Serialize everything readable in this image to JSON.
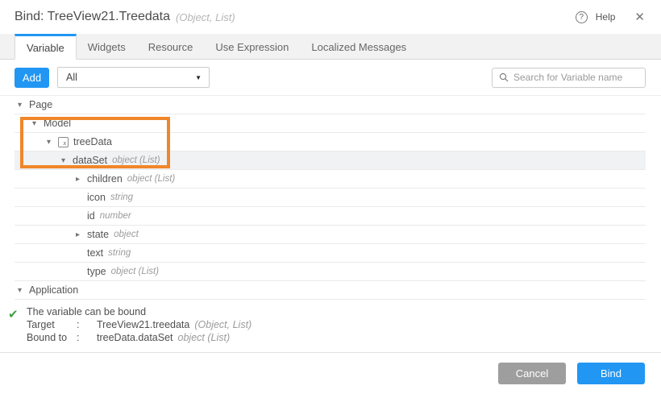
{
  "dialog": {
    "title": "Bind: TreeView21.Treedata",
    "title_type": "(Object, List)",
    "help_label": "Help",
    "help_glyph": "?",
    "close_glyph": "✕"
  },
  "tabs": [
    {
      "label": "Variable",
      "active": true
    },
    {
      "label": "Widgets",
      "active": false
    },
    {
      "label": "Resource",
      "active": false
    },
    {
      "label": "Use Expression",
      "active": false
    },
    {
      "label": "Localized Messages",
      "active": false
    }
  ],
  "toolbar": {
    "add_label": "Add",
    "filter_value": "All",
    "search_placeholder": "Search for Variable name"
  },
  "tree": {
    "rows": [
      {
        "label": "Page",
        "level": 0,
        "caret": "down"
      },
      {
        "label": "Model",
        "level": 1,
        "caret": "down"
      },
      {
        "label": "treeData",
        "level": 2,
        "caret": "down",
        "icon": "variable"
      },
      {
        "label": "dataSet",
        "type": "object (List)",
        "level": 3,
        "caret": "down",
        "selected": true
      },
      {
        "label": "children",
        "type": "object (List)",
        "level": 4,
        "caret": "right"
      },
      {
        "label": "icon",
        "type": "string",
        "level": 4
      },
      {
        "label": "id",
        "type": "number",
        "level": 4
      },
      {
        "label": "state",
        "type": "object",
        "level": 4,
        "caret": "right"
      },
      {
        "label": "text",
        "type": "string",
        "level": 4
      },
      {
        "label": "type",
        "type": "object (List)",
        "level": 4
      },
      {
        "label": "Application",
        "level": 0,
        "caret": "down"
      }
    ]
  },
  "status": {
    "message": "The variable can be bound",
    "check_glyph": "✔",
    "target_label": "Target",
    "colon": ":",
    "target_value": "TreeView21.treedata",
    "target_type": "(Object, List)",
    "bound_label": "Bound to",
    "bound_value": "treeData.dataSet",
    "bound_type": "object (List)"
  },
  "footer": {
    "cancel_label": "Cancel",
    "bind_label": "Bind"
  },
  "colors": {
    "accent_blue": "#2196f3",
    "highlight_orange": "#f0862a",
    "success_green": "#43a047",
    "selected_row": "#f1f2f4"
  }
}
